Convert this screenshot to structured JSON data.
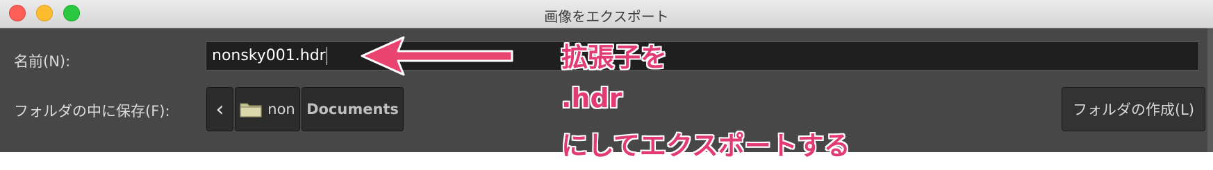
{
  "window": {
    "title": "画像をエクスポート"
  },
  "form": {
    "name_label": "名前(N):",
    "name_value": "nonsky001.hdr",
    "folder_label": "フォルダの中に保存(F):",
    "path_back": "‹",
    "path_home": "non",
    "path_current": "Documents",
    "create_folder_label": "フォルダの作成(L)"
  },
  "annotation": {
    "line1": "拡張子を",
    "line2": ".hdr",
    "line3": "にしてエクスポートする",
    "color": "#e23a73"
  },
  "icons": {
    "home_folder": "folder-icon",
    "back": "chevron-left-icon",
    "annotation_arrow": "arrow-left-icon"
  }
}
